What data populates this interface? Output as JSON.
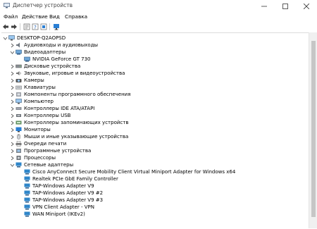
{
  "window": {
    "title": "Диспетчер устройств",
    "controls": [
      "minimize",
      "maximize",
      "close"
    ]
  },
  "menu": [
    "Файл",
    "Действие",
    "Вид",
    "Справка"
  ],
  "toolbar": [
    "back-icon",
    "forward-icon",
    "properties-icon",
    "help-icon",
    "update-driver-icon",
    "monitor-icon"
  ],
  "tree": {
    "root": "DESKTOP-Q2AOPSD",
    "items": [
      {
        "label": "Аудиовходы и аудиовыходы",
        "expanded": false,
        "icon": "audio-io-icon"
      },
      {
        "label": "Видеоадаптеры",
        "expanded": true,
        "icon": "display-adapter-icon",
        "children": [
          "NVIDIA GeForce GT 730"
        ]
      },
      {
        "label": "Дисковые устройства",
        "expanded": false,
        "icon": "disk-drive-icon"
      },
      {
        "label": "Звуковые, игровые и видеоустройства",
        "expanded": false,
        "icon": "sound-icon"
      },
      {
        "label": "Камеры",
        "expanded": false,
        "icon": "camera-icon"
      },
      {
        "label": "Клавиатуры",
        "expanded": false,
        "icon": "keyboard-icon"
      },
      {
        "label": "Компоненты программного обеспечения",
        "expanded": false,
        "icon": "software-component-icon"
      },
      {
        "label": "Компьютер",
        "expanded": false,
        "icon": "computer-icon"
      },
      {
        "label": "Контроллеры IDE ATA/ATAPI",
        "expanded": false,
        "icon": "ide-controller-icon"
      },
      {
        "label": "Контроллеры USB",
        "expanded": false,
        "icon": "usb-icon"
      },
      {
        "label": "Контроллеры запоминающих устройств",
        "expanded": false,
        "icon": "storage-controller-icon"
      },
      {
        "label": "Мониторы",
        "expanded": false,
        "icon": "monitor-icon"
      },
      {
        "label": "Мыши и иные указывающие устройства",
        "expanded": false,
        "icon": "mouse-icon"
      },
      {
        "label": "Очереди печати",
        "expanded": false,
        "icon": "printer-icon"
      },
      {
        "label": "Программные устройства",
        "expanded": false,
        "icon": "software-device-icon"
      },
      {
        "label": "Процессоры",
        "expanded": false,
        "icon": "processor-icon"
      },
      {
        "label": "Сетевые адаптеры",
        "expanded": true,
        "icon": "network-adapter-icon",
        "children": [
          "Cisco AnyConnect Secure Mobility Client Virtual Miniport Adapter for Windows x64",
          "Realtek PCIe GbE Family Controller",
          "TAP-Windows Adapter V9",
          "TAP-Windows Adapter V9 #2",
          "TAP-Windows Adapter V9 #3",
          "VPN Client Adapter - VPN",
          "WAN Miniport (IKEv2)"
        ]
      }
    ]
  },
  "colors": {
    "monitor_blue": "#2a7fd4",
    "network_blue": "#2f86c9",
    "arrow_gray": "#5a5a5a"
  }
}
